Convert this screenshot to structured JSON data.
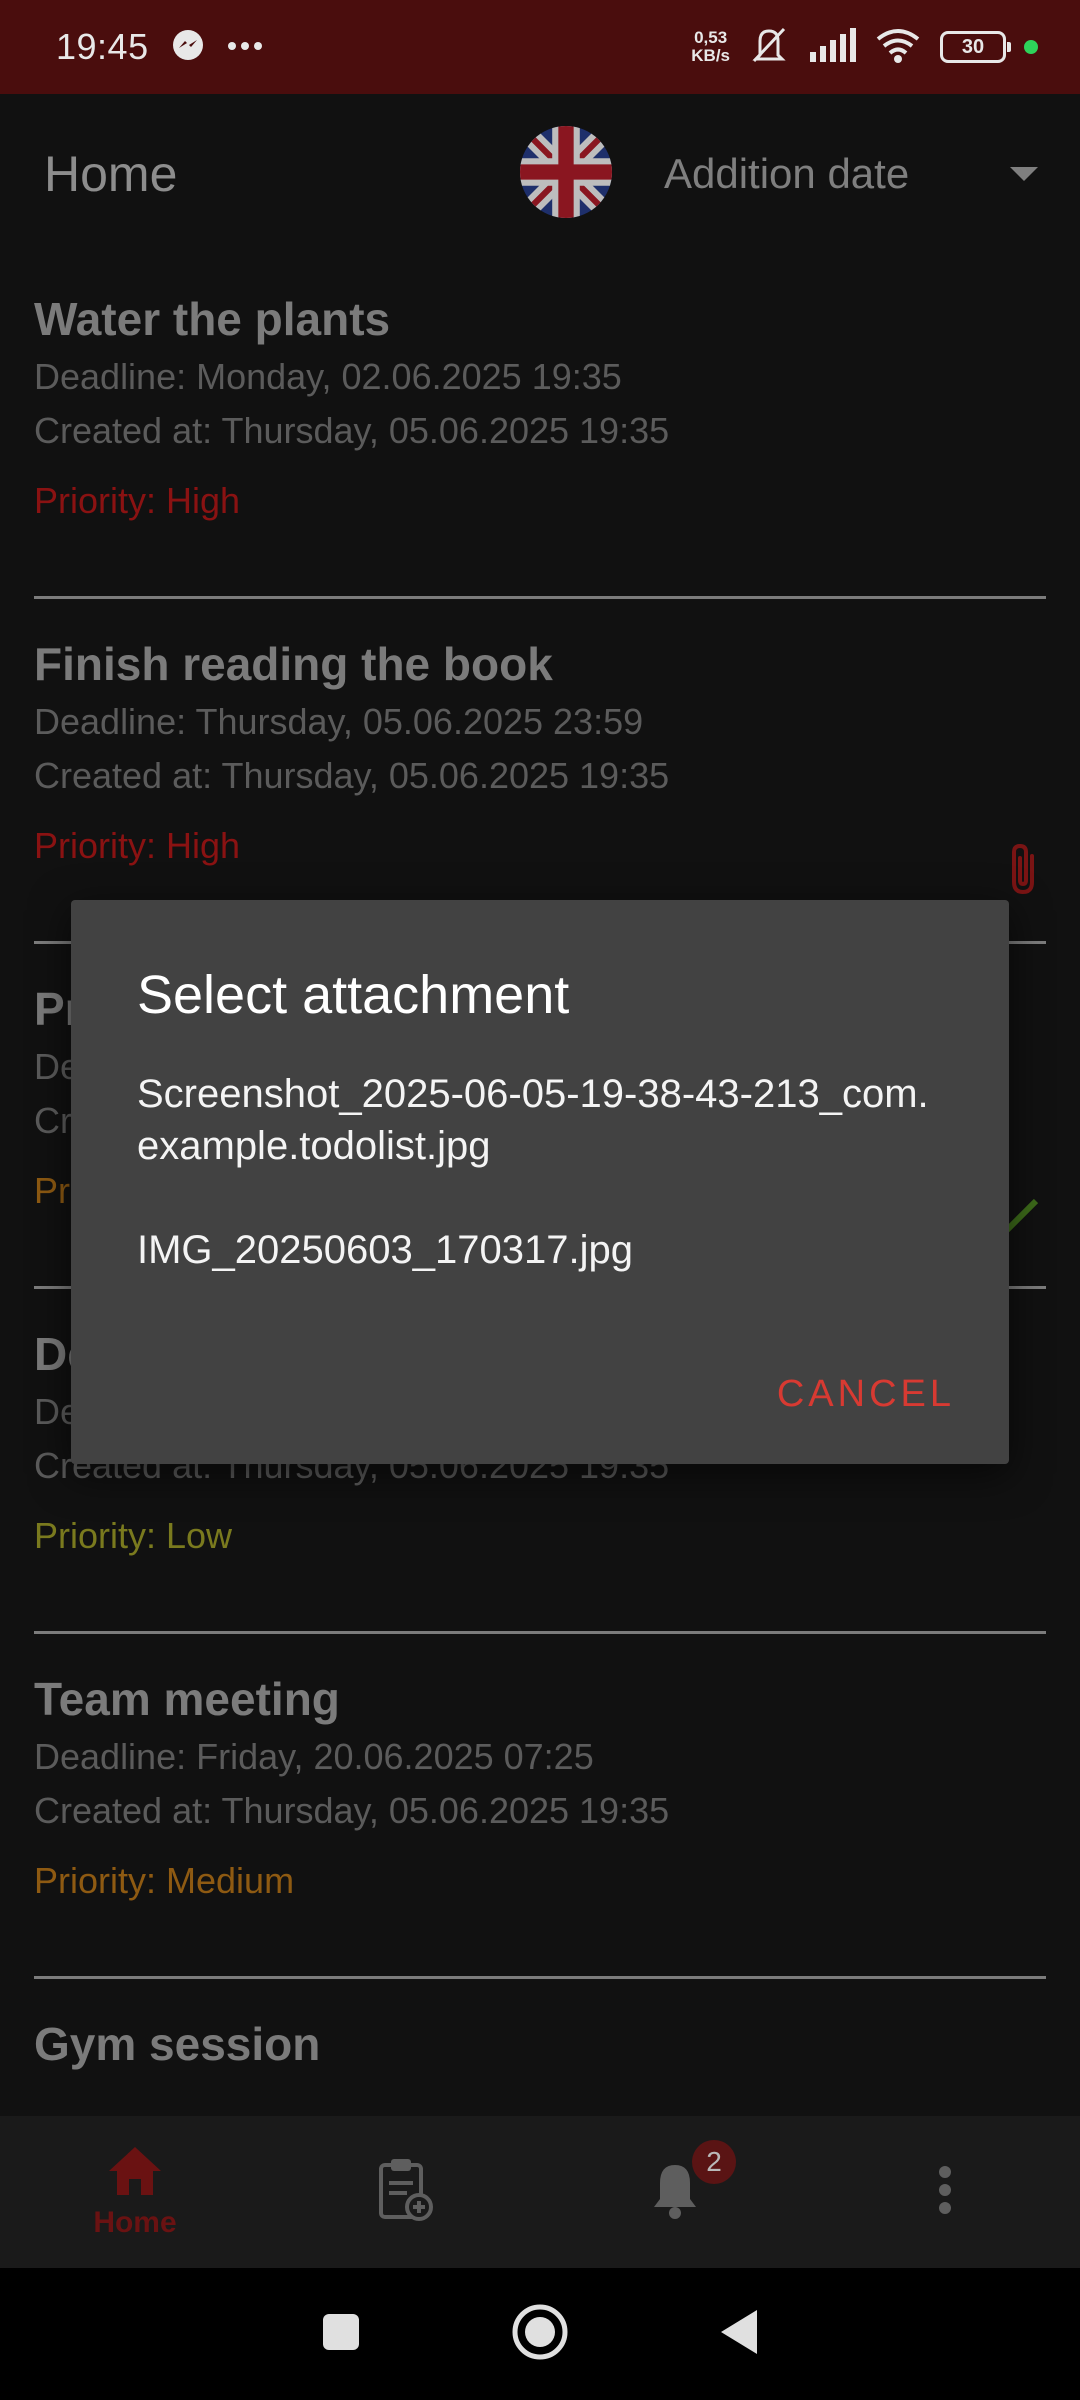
{
  "status_bar": {
    "time": "19:45",
    "net_speed_value": "0,53",
    "net_speed_unit": "KB/s",
    "battery": "30"
  },
  "app_bar": {
    "title": "Home",
    "sort_label": "Addition date"
  },
  "tasks": [
    {
      "title": "Water the plants",
      "deadline": "Deadline: Monday, 02.06.2025 19:35",
      "created": "Created at: Thursday, 05.06.2025 19:35",
      "priority": "Priority: High"
    },
    {
      "title": "Finish reading the book",
      "deadline": "Deadline: Thursday, 05.06.2025 23:59",
      "created": "Created at: Thursday, 05.06.2025 19:35",
      "priority": "Priority: High",
      "icon": "paperclip-icon"
    },
    {
      "title": "Pr",
      "deadline": "De",
      "created": "Cr",
      "priority": "Pr",
      "icon": "checkmark-icon"
    },
    {
      "title": "De",
      "deadline": "De",
      "created": "Created at: Thursday, 05.06.2025 19:35",
      "priority": "Priority: Low"
    },
    {
      "title": "Team meeting",
      "deadline": "Deadline: Friday, 20.06.2025 07:25",
      "created": "Created at: Thursday, 05.06.2025 19:35",
      "priority": "Priority: Medium"
    },
    {
      "title": "Gym session",
      "deadline": "",
      "created": "",
      "priority": ""
    }
  ],
  "dialog": {
    "title": "Select attachment",
    "items": [
      "Screenshot_2025-06-05-19-38-43-213_com.example.todolist.jpg",
      "IMG_20250603_170317.jpg"
    ],
    "cancel_label": "CANCEL"
  },
  "bottom_nav": {
    "home_label": "Home",
    "notification_count": "2"
  },
  "colors": {
    "accent": "#d73a32",
    "status_bar": "#4a0d0d",
    "dialog_bg": "#424242"
  }
}
